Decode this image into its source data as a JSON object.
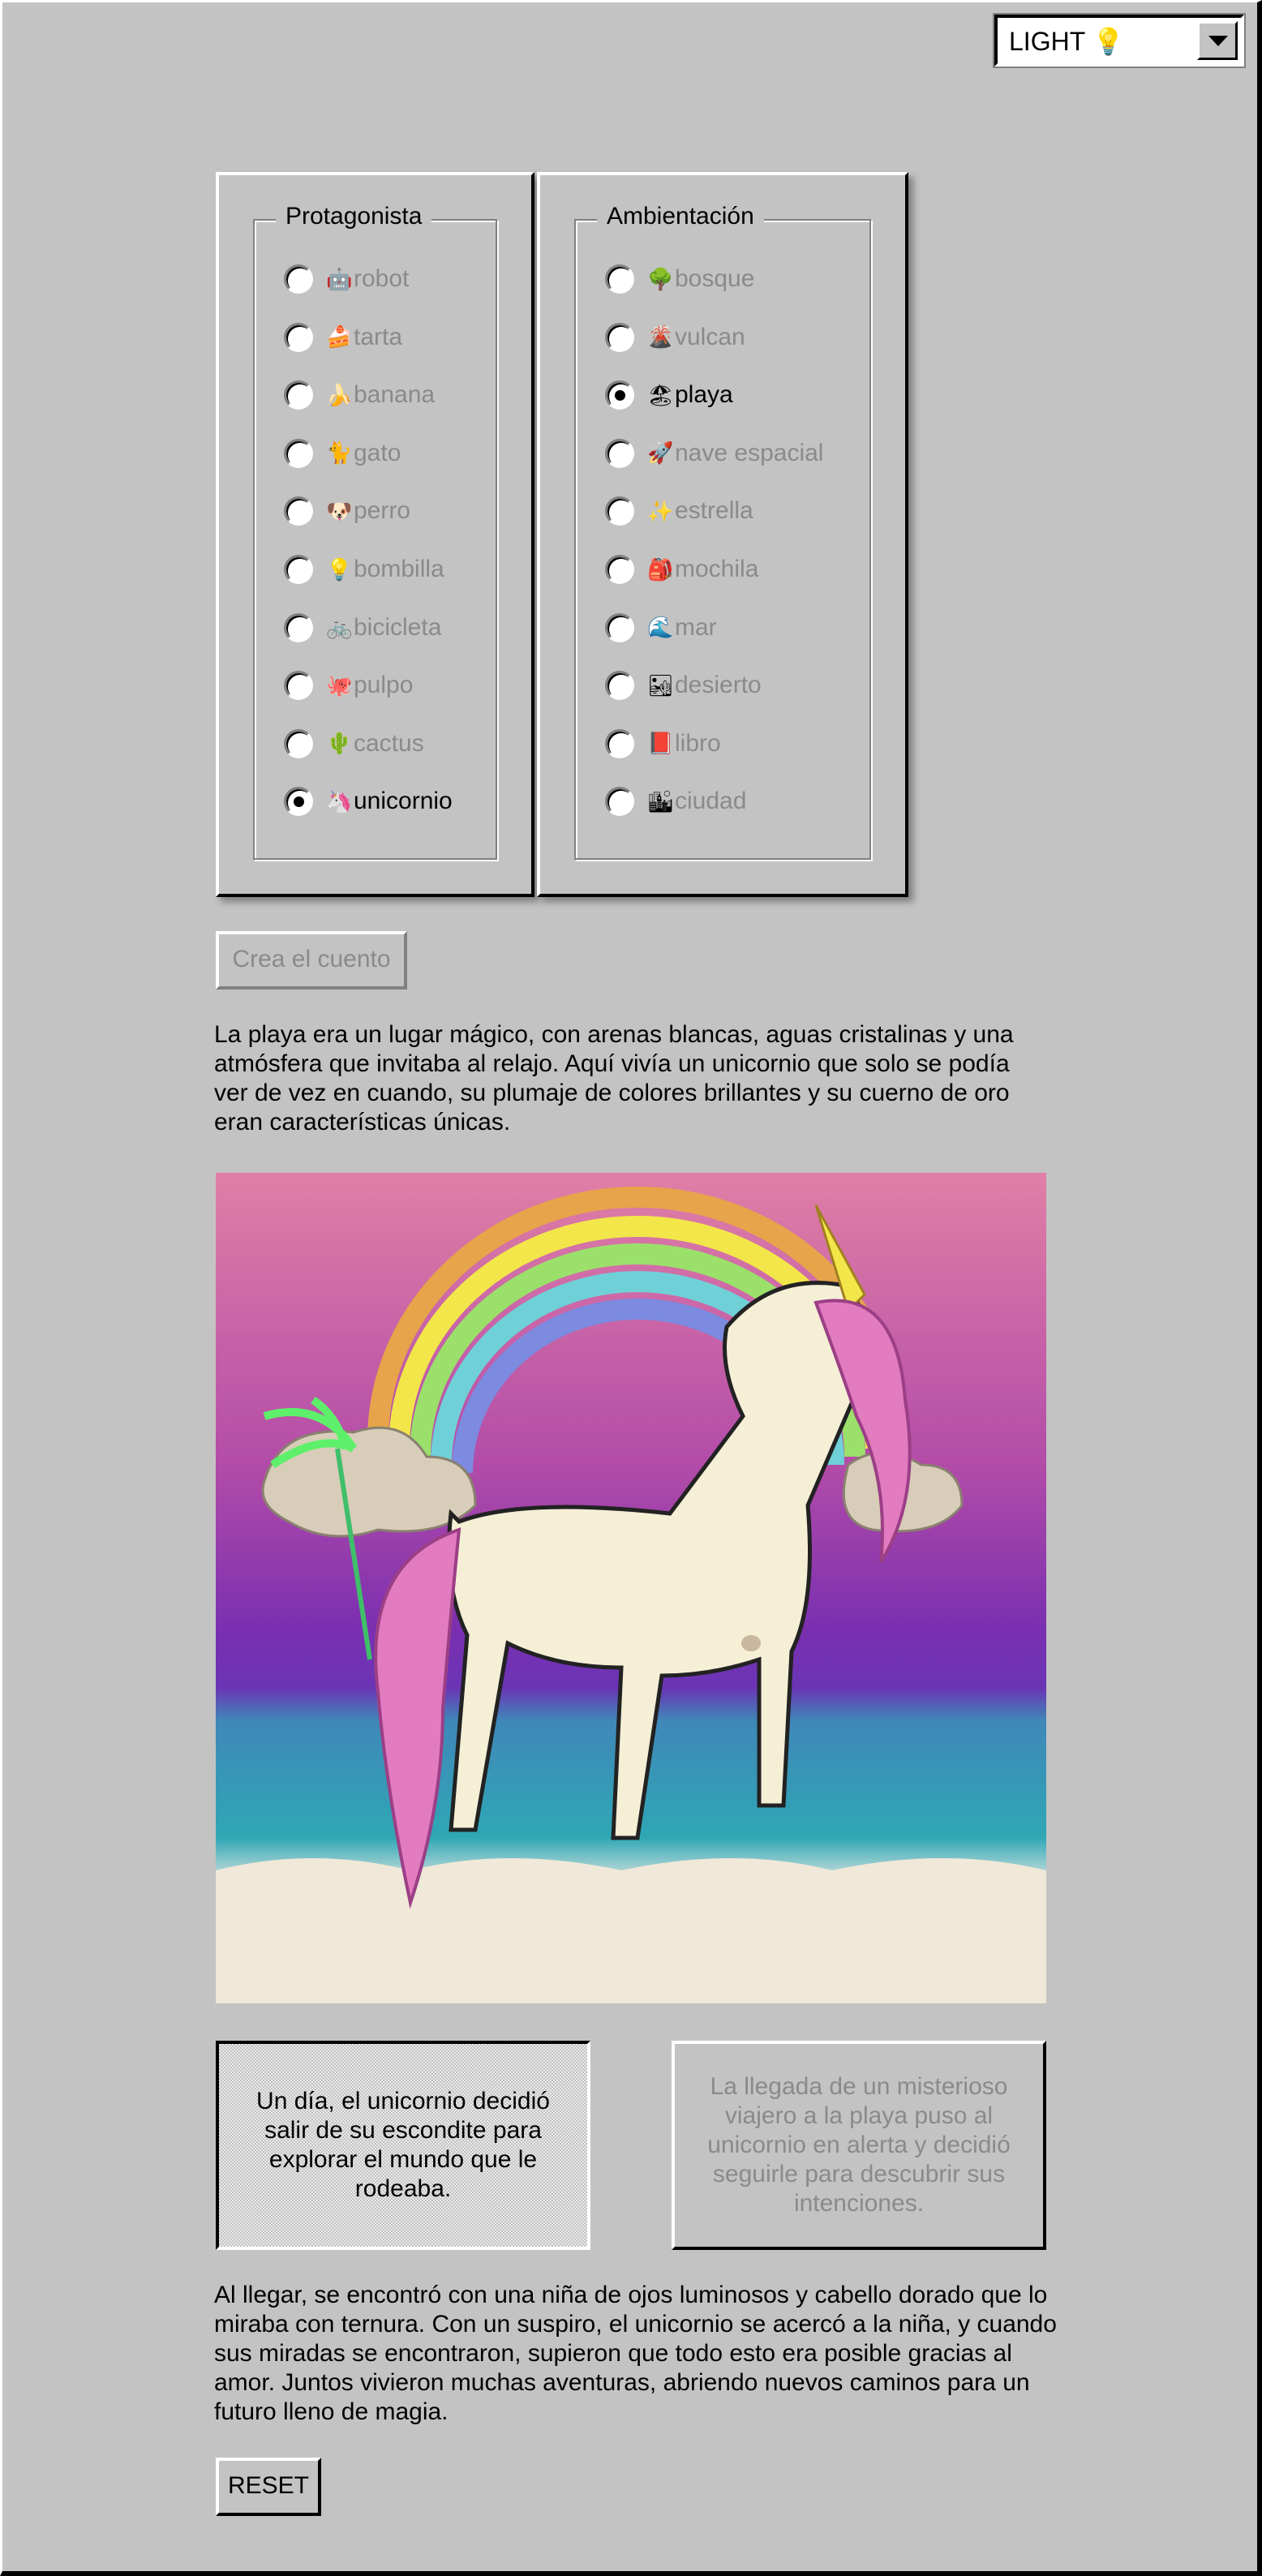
{
  "theme": {
    "value": "LIGHT",
    "icon": "💡"
  },
  "protagonist": {
    "legend": "Protagonista",
    "selected": "unicornio",
    "options": [
      {
        "icon": "🤖",
        "label": "robot"
      },
      {
        "icon": "🍰",
        "label": "tarta"
      },
      {
        "icon": "🍌",
        "label": "banana"
      },
      {
        "icon": "🐈",
        "label": "gato"
      },
      {
        "icon": "🐶",
        "label": "perro"
      },
      {
        "icon": "💡",
        "label": "bombilla"
      },
      {
        "icon": "🚲",
        "label": "bicicleta"
      },
      {
        "icon": "🐙",
        "label": "pulpo"
      },
      {
        "icon": "🌵",
        "label": "cactus"
      },
      {
        "icon": "🦄",
        "label": "unicornio"
      }
    ]
  },
  "setting": {
    "legend": "Ambientación",
    "selected": "playa",
    "options": [
      {
        "icon": "🌳",
        "label": "bosque"
      },
      {
        "icon": "🌋",
        "label": "vulcan"
      },
      {
        "icon": "🏖",
        "label": "playa"
      },
      {
        "icon": "🚀",
        "label": "nave espacial"
      },
      {
        "icon": "✨",
        "label": "estrella"
      },
      {
        "icon": "🎒",
        "label": "mochila"
      },
      {
        "icon": "🌊",
        "label": "mar"
      },
      {
        "icon": "🏜",
        "label": "desierto"
      },
      {
        "icon": "📕",
        "label": "libro"
      },
      {
        "icon": "🏙",
        "label": "ciudad"
      }
    ]
  },
  "create_button": "Crea el cuento",
  "story": {
    "intro": "La playa era un lugar mágico, con arenas blancas, aguas cristalinas y una atmósfera que invitaba al relajo. Aquí vivía un unicornio que solo se podía ver de vez en cuando, su plumaje de colores brillantes y su cuerno de oro eran características únicas.",
    "choice_a": "Un día, el unicornio decidió salir de su escondite para explorar el mundo que le rodeaba.",
    "choice_b": "La llegada de un misterioso viajero a la playa puso al unicornio en alerta y decidió seguirle para descubrir sus intenciones.",
    "ending": "Al llegar, se encontró con una niña de ojos luminosos y cabello dorado que lo miraba con ternura. Con un suspiro, el unicornio se acercó a la niña, y cuando sus miradas se encontraron, supieron que todo esto era posible gracias al amor. Juntos vivieron muchas aventuras, abriendo nuevos caminos para un futuro lleno de magia."
  },
  "reset_button": "RESET",
  "colors": {
    "background": "#c3c3c3",
    "disabled_text": "#8a8a8a"
  }
}
